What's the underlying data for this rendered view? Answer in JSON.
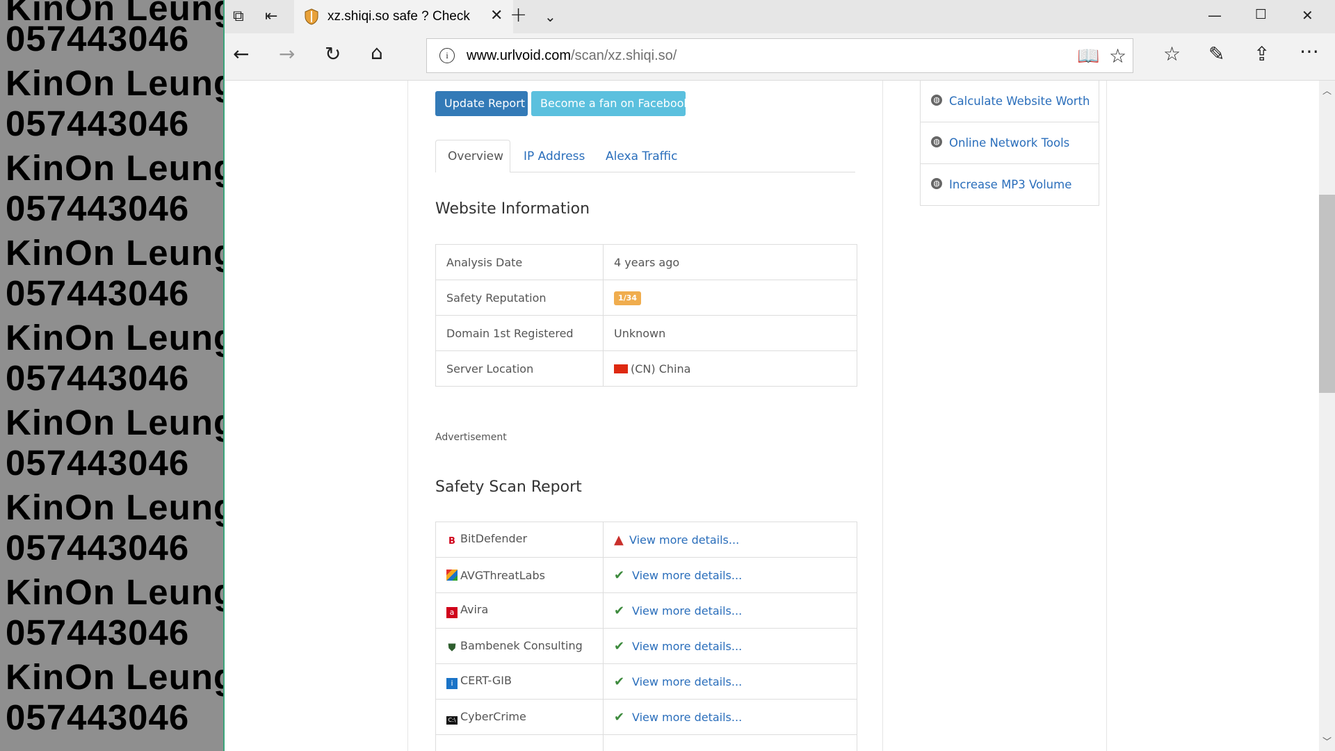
{
  "watermark": {
    "lines": [
      "KinOn Leung",
      "057443046",
      "KinOn Leung",
      "057443046",
      "KinOn Leung",
      "057443046",
      "KinOn Leung",
      "057443046",
      "KinOn Leung",
      "057443046",
      "KinOn Leung",
      "057443046",
      "KinOn Leung",
      "057443046",
      "KinOn Leung",
      "057443046",
      "KinOn Leung",
      "057443046"
    ]
  },
  "browser": {
    "tab_title": "xz.shiqi.so safe ? Check",
    "url_host": "www.urlvoid.com",
    "url_path": "/scan/xz.shiqi.so/"
  },
  "page": {
    "update_report": "Update Report",
    "facebook": "Become a fan on Facebook",
    "tabs": [
      "Overview",
      "IP Address",
      "Alexa Traffic"
    ],
    "website_info_title": "Website Information",
    "info_rows": [
      {
        "label": "Analysis Date",
        "value": "4 years ago"
      },
      {
        "label": "Safety Reputation",
        "value": "1/34"
      },
      {
        "label": "Domain 1st Registered",
        "value": "Unknown"
      },
      {
        "label": "Server Location",
        "value": "(CN) China"
      }
    ],
    "advertisement": "Advertisement",
    "scan_title": "Safety Scan Report",
    "scan_rows": [
      {
        "engine": "BitDefender",
        "status": "warning",
        "link": "View more details..."
      },
      {
        "engine": "AVGThreatLabs",
        "status": "clean",
        "link": "View more details..."
      },
      {
        "engine": "Avira",
        "status": "clean",
        "link": "View more details..."
      },
      {
        "engine": "Bambenek Consulting",
        "status": "clean",
        "link": "View more details..."
      },
      {
        "engine": "CERT-GIB",
        "status": "clean",
        "link": "View more details..."
      },
      {
        "engine": "CyberCrime",
        "status": "clean",
        "link": "View more details..."
      }
    ],
    "sidebar": [
      "Calculate Website Worth",
      "Online Network Tools",
      "Increase MP3 Volume"
    ]
  },
  "colors": {
    "primary_button": "#337ab7",
    "info_button": "#5bc0de",
    "badge": "#f0ad4e",
    "link": "#2a6ebb"
  }
}
